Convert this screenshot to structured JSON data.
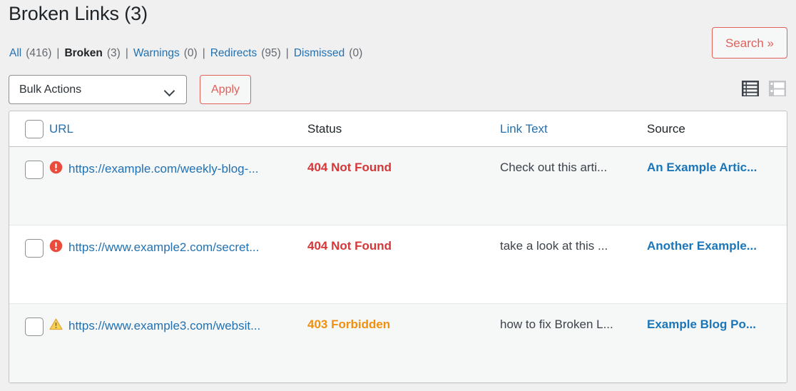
{
  "page": {
    "title": "Broken Links (3)"
  },
  "filters": {
    "items": [
      {
        "label": "All",
        "count": "(416)",
        "current": false
      },
      {
        "label": "Broken",
        "count": "(3)",
        "current": true
      },
      {
        "label": "Warnings",
        "count": "(0)",
        "current": false
      },
      {
        "label": "Redirects",
        "count": "(95)",
        "current": false
      },
      {
        "label": "Dismissed",
        "count": "(0)",
        "current": false
      }
    ],
    "separator": "|"
  },
  "search": {
    "label": "Search »"
  },
  "tablenav": {
    "bulk_actions_selected": "Bulk Actions",
    "bulk_actions_options": [
      "Bulk Actions"
    ],
    "apply_label": "Apply",
    "chevron_icon": "chevron-down-icon"
  },
  "view_switch": {
    "list_icon": "list-view-icon",
    "list_active": true,
    "grid_icon": "grid-view-icon",
    "grid_active": false
  },
  "table": {
    "columns": [
      {
        "key": "url",
        "label": "URL",
        "sortable": true
      },
      {
        "key": "status",
        "label": "Status",
        "sortable": false
      },
      {
        "key": "link",
        "label": "Link Text",
        "sortable": true
      },
      {
        "key": "source",
        "label": "Source",
        "sortable": false
      }
    ],
    "rows": [
      {
        "icon": "error-circle-icon",
        "url": "https://example.com/weekly-blog-...",
        "status": "404 Not Found",
        "status_kind": "error",
        "link_text": "Check out this arti...",
        "source": "An Example Artic..."
      },
      {
        "icon": "error-circle-icon",
        "url": "https://www.example2.com/secret...",
        "status": "404 Not Found",
        "status_kind": "error",
        "link_text": "take a look at this ...",
        "source": "Another Example..."
      },
      {
        "icon": "warning-triangle-icon",
        "url": "https://www.example3.com/websit...",
        "status": "403 Forbidden",
        "status_kind": "warning",
        "link_text": "how to fix Broken L...",
        "source": "Example Blog Po..."
      }
    ]
  },
  "colors": {
    "link": "#2271b1",
    "error": "#d63638",
    "warning": "#f0900f",
    "accent_red": "#e2605a",
    "source_link": "#1b76b9",
    "page_bg": "#f0f0f1",
    "row_alt": "#f6f7f7"
  }
}
